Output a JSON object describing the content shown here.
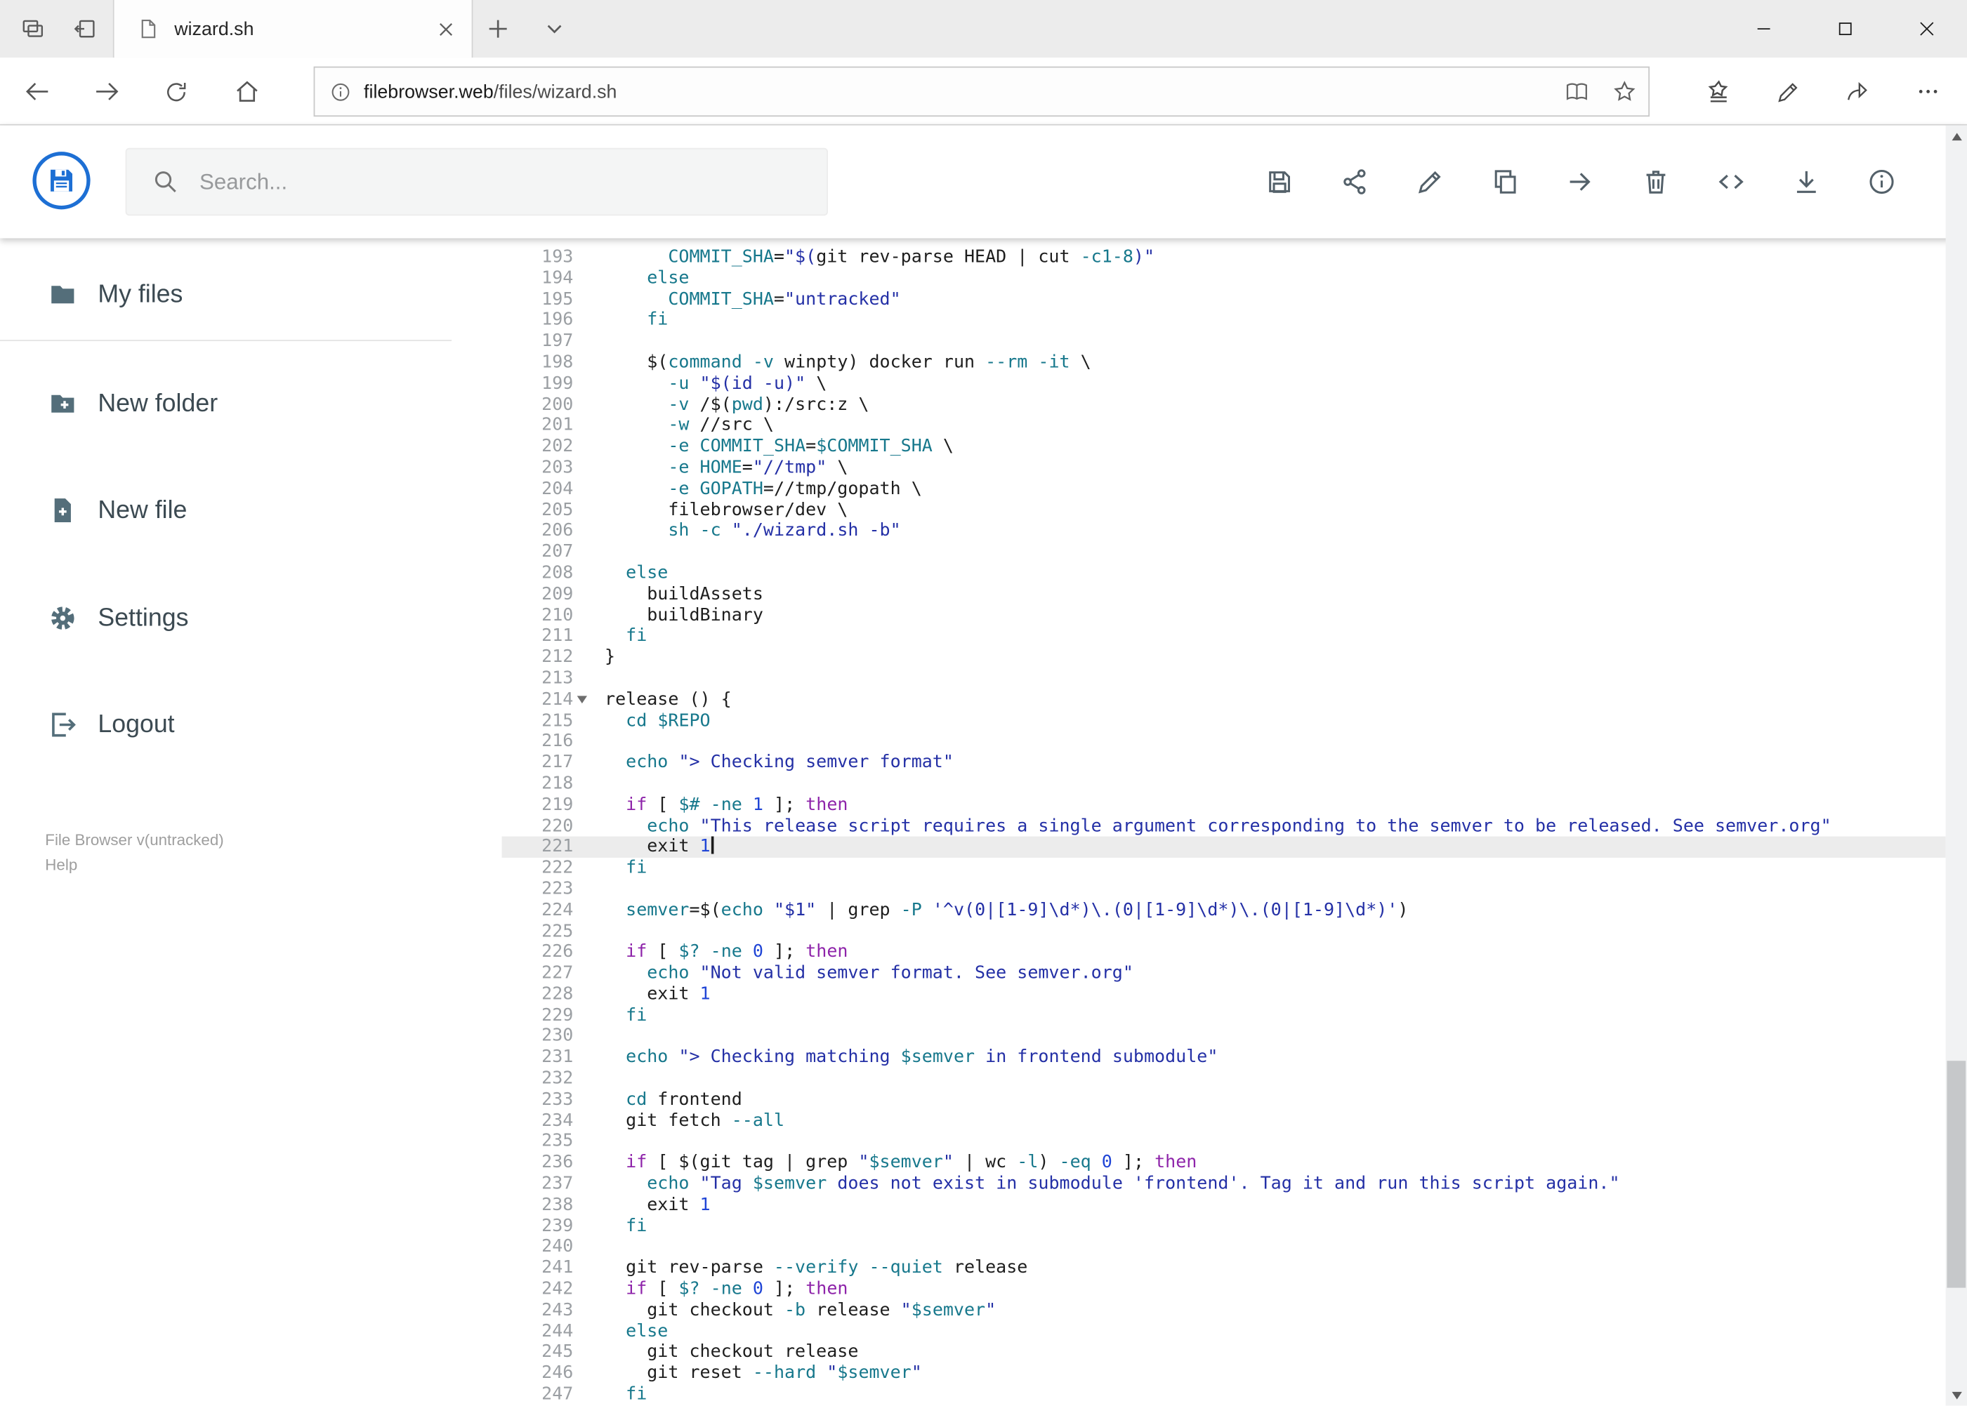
{
  "browser": {
    "tab": {
      "title": "wizard.sh"
    },
    "window_controls": [
      "minimize-icon",
      "maximize-icon",
      "close-icon"
    ],
    "address": {
      "domain": "filebrowser.web",
      "path": "/files/wizard.sh"
    }
  },
  "header": {
    "search": {
      "placeholder": "Search..."
    },
    "toolbar_icons": [
      "save-icon",
      "share-icon",
      "rename-icon",
      "copy-icon",
      "move-icon",
      "delete-icon",
      "code-view-icon",
      "download-icon",
      "info-icon"
    ]
  },
  "icons": {
    "tab_strip": [
      "tab-preview-icon",
      "tabs-aside-icon",
      "document-icon",
      "close-icon",
      "new-tab-icon",
      "tab-list-chevron-icon"
    ],
    "address_bar": [
      "back-icon",
      "forward-icon",
      "refresh-icon",
      "home-icon",
      "site-info-icon",
      "reading-view-icon",
      "favorite-star-icon",
      "hub-icon",
      "web-note-pen-icon",
      "share-icon",
      "more-icon"
    ],
    "sidebar": [
      "folder-icon",
      "new-folder-icon",
      "new-file-icon",
      "settings-gear-icon",
      "logout-icon"
    ],
    "search": "search-icon",
    "logo": "filebrowser-floppy-logo"
  },
  "sidebar": {
    "items": [
      {
        "icon": "folder-icon",
        "label": "My files"
      },
      {
        "icon": "new-folder-icon",
        "label": "New folder"
      },
      {
        "icon": "new-file-icon",
        "label": "New file"
      },
      {
        "icon": "settings-gear-icon",
        "label": "Settings"
      },
      {
        "icon": "logout-icon",
        "label": "Logout"
      }
    ],
    "footer": {
      "version": "File Browser v(untracked)",
      "help": "Help"
    }
  },
  "colors": {
    "accent_blue": "#1d6fd4",
    "toolbar_icon": "#54616a",
    "active_line_bg": "#ececec",
    "syntax": {
      "plain": "#1e1e1e",
      "keyword": "#8e24aa",
      "builtin_var_flag": "#17788c",
      "string": "#2430a6",
      "number": "#2045d6"
    }
  },
  "editor": {
    "active_line": 221,
    "fold_line": 214,
    "first_line": 193,
    "last_line": 247,
    "lines": [
      {
        "n": 193,
        "s": [
          [
            "      COMMIT_SHA",
            "t"
          ],
          [
            "=",
            "p"
          ],
          [
            "\"$(",
            "s"
          ],
          [
            "git rev-parse HEAD | cut ",
            "p"
          ],
          [
            "-c1-8",
            "t"
          ],
          [
            ")\"",
            "s"
          ]
        ]
      },
      {
        "n": 194,
        "s": [
          [
            "    else",
            "t"
          ]
        ]
      },
      {
        "n": 195,
        "s": [
          [
            "      COMMIT_SHA",
            "t"
          ],
          [
            "=",
            "p"
          ],
          [
            "\"untracked\"",
            "s"
          ]
        ]
      },
      {
        "n": 196,
        "s": [
          [
            "    fi",
            "t"
          ]
        ]
      },
      {
        "n": 197,
        "s": []
      },
      {
        "n": 198,
        "s": [
          [
            "    $(",
            "p"
          ],
          [
            "command",
            "t"
          ],
          [
            " ",
            "p"
          ],
          [
            "-v",
            "t"
          ],
          [
            " winpty) docker run ",
            "p"
          ],
          [
            "--rm",
            "t"
          ],
          [
            " ",
            "p"
          ],
          [
            "-it",
            "t"
          ],
          [
            " \\",
            "p"
          ]
        ]
      },
      {
        "n": 199,
        "s": [
          [
            "      -u",
            "t"
          ],
          [
            " ",
            "p"
          ],
          [
            "\"$(id -u)\"",
            "s"
          ],
          [
            " \\",
            "p"
          ]
        ]
      },
      {
        "n": 200,
        "s": [
          [
            "      -v",
            "t"
          ],
          [
            " /$(",
            "p"
          ],
          [
            "pwd",
            "t"
          ],
          [
            "):/src:z \\",
            "p"
          ]
        ]
      },
      {
        "n": 201,
        "s": [
          [
            "      -w",
            "t"
          ],
          [
            " //src \\",
            "p"
          ]
        ]
      },
      {
        "n": 202,
        "s": [
          [
            "      -e",
            "t"
          ],
          [
            " ",
            "p"
          ],
          [
            "COMMIT_SHA",
            "t"
          ],
          [
            "=",
            "p"
          ],
          [
            "$COMMIT_SHA",
            "t"
          ],
          [
            " \\",
            "p"
          ]
        ]
      },
      {
        "n": 203,
        "s": [
          [
            "      -e",
            "t"
          ],
          [
            " ",
            "p"
          ],
          [
            "HOME",
            "t"
          ],
          [
            "=",
            "p"
          ],
          [
            "\"//tmp\"",
            "s"
          ],
          [
            " \\",
            "p"
          ]
        ]
      },
      {
        "n": 204,
        "s": [
          [
            "      -e",
            "t"
          ],
          [
            " ",
            "p"
          ],
          [
            "GOPATH",
            "t"
          ],
          [
            "=//tmp/gopath \\",
            "p"
          ]
        ]
      },
      {
        "n": 205,
        "s": [
          [
            "      filebrowser/dev \\",
            "p"
          ]
        ]
      },
      {
        "n": 206,
        "s": [
          [
            "      sh",
            "t"
          ],
          [
            " ",
            "p"
          ],
          [
            "-c",
            "t"
          ],
          [
            " ",
            "p"
          ],
          [
            "\"./wizard.sh -b\"",
            "s"
          ]
        ]
      },
      {
        "n": 207,
        "s": []
      },
      {
        "n": 208,
        "s": [
          [
            "  else",
            "t"
          ]
        ]
      },
      {
        "n": 209,
        "s": [
          [
            "    buildAssets",
            "p"
          ]
        ]
      },
      {
        "n": 210,
        "s": [
          [
            "    buildBinary",
            "p"
          ]
        ]
      },
      {
        "n": 211,
        "s": [
          [
            "  fi",
            "t"
          ]
        ]
      },
      {
        "n": 212,
        "s": [
          [
            "}",
            "p"
          ]
        ]
      },
      {
        "n": 213,
        "s": []
      },
      {
        "n": 214,
        "s": [
          [
            "release () {",
            "p"
          ]
        ]
      },
      {
        "n": 215,
        "s": [
          [
            "  cd",
            "t"
          ],
          [
            " ",
            "p"
          ],
          [
            "$REPO",
            "t"
          ]
        ]
      },
      {
        "n": 216,
        "s": []
      },
      {
        "n": 217,
        "s": [
          [
            "  echo",
            "t"
          ],
          [
            " ",
            "p"
          ],
          [
            "\"> Checking semver format\"",
            "s"
          ]
        ]
      },
      {
        "n": 218,
        "s": []
      },
      {
        "n": 219,
        "s": [
          [
            "  if",
            "k"
          ],
          [
            " [ ",
            "p"
          ],
          [
            "$#",
            "t"
          ],
          [
            " ",
            "p"
          ],
          [
            "-ne",
            "t"
          ],
          [
            " ",
            "p"
          ],
          [
            "1",
            "n"
          ],
          [
            " ]; ",
            "p"
          ],
          [
            "then",
            "k"
          ]
        ]
      },
      {
        "n": 220,
        "s": [
          [
            "    echo",
            "t"
          ],
          [
            " ",
            "p"
          ],
          [
            "\"This release script requires a single argument corresponding to the semver to be released. See semver.org\"",
            "s"
          ]
        ]
      },
      {
        "n": 221,
        "s": [
          [
            "    exit ",
            "p"
          ],
          [
            "1",
            "n"
          ]
        ]
      },
      {
        "n": 222,
        "s": [
          [
            "  fi",
            "t"
          ]
        ]
      },
      {
        "n": 223,
        "s": []
      },
      {
        "n": 224,
        "s": [
          [
            "  semver",
            "t"
          ],
          [
            "=$(",
            "p"
          ],
          [
            "echo",
            "t"
          ],
          [
            " ",
            "p"
          ],
          [
            "\"$1\"",
            "s"
          ],
          [
            " | grep ",
            "p"
          ],
          [
            "-P",
            "t"
          ],
          [
            " ",
            "p"
          ],
          [
            "'^v(0|[1-9]\\d*)\\.(0|[1-9]\\d*)\\.(0|[1-9]\\d*)'",
            "s"
          ],
          [
            ")",
            "p"
          ]
        ]
      },
      {
        "n": 225,
        "s": []
      },
      {
        "n": 226,
        "s": [
          [
            "  if",
            "k"
          ],
          [
            " [ ",
            "p"
          ],
          [
            "$?",
            "t"
          ],
          [
            " ",
            "p"
          ],
          [
            "-ne",
            "t"
          ],
          [
            " ",
            "p"
          ],
          [
            "0",
            "n"
          ],
          [
            " ]; ",
            "p"
          ],
          [
            "then",
            "k"
          ]
        ]
      },
      {
        "n": 227,
        "s": [
          [
            "    echo",
            "t"
          ],
          [
            " ",
            "p"
          ],
          [
            "\"Not valid semver format. See semver.org\"",
            "s"
          ]
        ]
      },
      {
        "n": 228,
        "s": [
          [
            "    exit ",
            "p"
          ],
          [
            "1",
            "n"
          ]
        ]
      },
      {
        "n": 229,
        "s": [
          [
            "  fi",
            "t"
          ]
        ]
      },
      {
        "n": 230,
        "s": []
      },
      {
        "n": 231,
        "s": [
          [
            "  echo",
            "t"
          ],
          [
            " ",
            "p"
          ],
          [
            "\"> Checking matching ",
            "s"
          ],
          [
            "$semver",
            "t"
          ],
          [
            " in frontend submodule\"",
            "s"
          ]
        ]
      },
      {
        "n": 232,
        "s": []
      },
      {
        "n": 233,
        "s": [
          [
            "  cd",
            "t"
          ],
          [
            " frontend",
            "p"
          ]
        ]
      },
      {
        "n": 234,
        "s": [
          [
            "  git fetch ",
            "p"
          ],
          [
            "--all",
            "t"
          ]
        ]
      },
      {
        "n": 235,
        "s": []
      },
      {
        "n": 236,
        "s": [
          [
            "  if",
            "k"
          ],
          [
            " [ $(git tag | grep ",
            "p"
          ],
          [
            "\"",
            "s"
          ],
          [
            "$semver",
            "t"
          ],
          [
            "\"",
            "s"
          ],
          [
            " | wc ",
            "p"
          ],
          [
            "-l",
            "t"
          ],
          [
            ") ",
            "p"
          ],
          [
            "-eq",
            "t"
          ],
          [
            " ",
            "p"
          ],
          [
            "0",
            "n"
          ],
          [
            " ]; ",
            "p"
          ],
          [
            "then",
            "k"
          ]
        ]
      },
      {
        "n": 237,
        "s": [
          [
            "    echo",
            "t"
          ],
          [
            " ",
            "p"
          ],
          [
            "\"Tag ",
            "s"
          ],
          [
            "$semver",
            "t"
          ],
          [
            " does not exist in submodule 'frontend'. Tag it and run this script again.\"",
            "s"
          ]
        ]
      },
      {
        "n": 238,
        "s": [
          [
            "    exit ",
            "p"
          ],
          [
            "1",
            "n"
          ]
        ]
      },
      {
        "n": 239,
        "s": [
          [
            "  fi",
            "t"
          ]
        ]
      },
      {
        "n": 240,
        "s": []
      },
      {
        "n": 241,
        "s": [
          [
            "  git rev-parse ",
            "p"
          ],
          [
            "--verify",
            "t"
          ],
          [
            " ",
            "p"
          ],
          [
            "--quiet",
            "t"
          ],
          [
            " release",
            "p"
          ]
        ]
      },
      {
        "n": 242,
        "s": [
          [
            "  if",
            "k"
          ],
          [
            " [ ",
            "p"
          ],
          [
            "$?",
            "t"
          ],
          [
            " ",
            "p"
          ],
          [
            "-ne",
            "t"
          ],
          [
            " ",
            "p"
          ],
          [
            "0",
            "n"
          ],
          [
            " ]; ",
            "p"
          ],
          [
            "then",
            "k"
          ]
        ]
      },
      {
        "n": 243,
        "s": [
          [
            "    git checkout ",
            "p"
          ],
          [
            "-b",
            "t"
          ],
          [
            " release ",
            "p"
          ],
          [
            "\"",
            "s"
          ],
          [
            "$semver",
            "t"
          ],
          [
            "\"",
            "s"
          ]
        ]
      },
      {
        "n": 244,
        "s": [
          [
            "  else",
            "t"
          ]
        ]
      },
      {
        "n": 245,
        "s": [
          [
            "    git checkout release",
            "p"
          ]
        ]
      },
      {
        "n": 246,
        "s": [
          [
            "    git reset ",
            "p"
          ],
          [
            "--hard",
            "t"
          ],
          [
            " ",
            "p"
          ],
          [
            "\"",
            "s"
          ],
          [
            "$semver",
            "t"
          ],
          [
            "\"",
            "s"
          ]
        ]
      },
      {
        "n": 247,
        "s": [
          [
            "  fi",
            "t"
          ]
        ]
      }
    ]
  }
}
